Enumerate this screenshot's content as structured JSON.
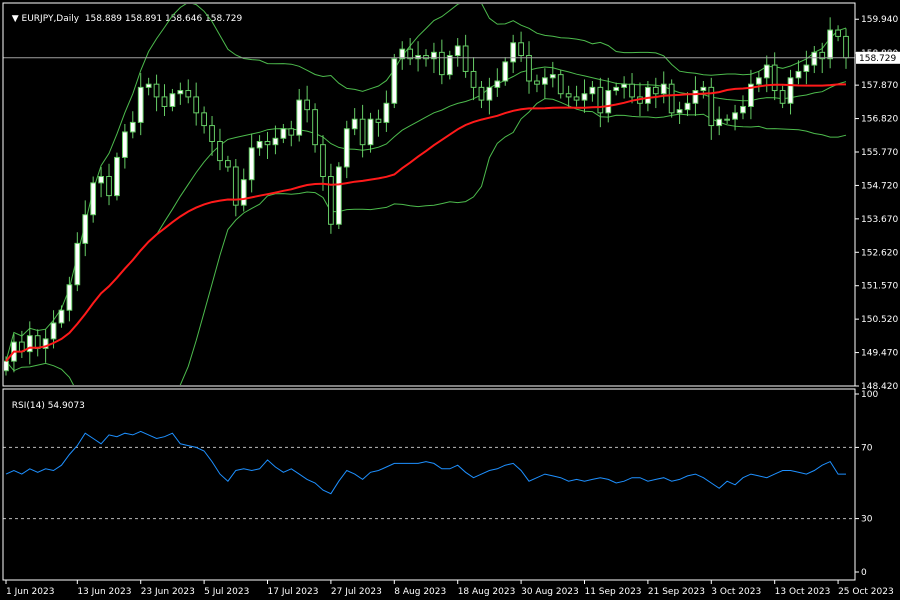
{
  "header": {
    "symbol": "EURJPY,Daily",
    "ohlc": "158.889 158.891 158.646 158.729"
  },
  "chart_data": {
    "type": "candlestick",
    "symbol": "EURJPY",
    "timeframe": "Daily",
    "price_axis": {
      "ylim": [
        148.42,
        160.45
      ],
      "ticks": [
        "159.940",
        "158.880",
        "157.870",
        "156.820",
        "155.770",
        "154.720",
        "153.670",
        "152.620",
        "151.570",
        "150.520",
        "149.470",
        "148.420"
      ]
    },
    "current_price": "158.729",
    "time_axis": {
      "ticks": [
        {
          "label": "1 Jun 2023",
          "index": 0
        },
        {
          "label": "13 Jun 2023",
          "index": 9
        },
        {
          "label": "23 Jun 2023",
          "index": 17
        },
        {
          "label": "5 Jul 2023",
          "index": 25
        },
        {
          "label": "17 Jul 2023",
          "index": 33
        },
        {
          "label": "27 Jul 2023",
          "index": 41
        },
        {
          "label": "8 Aug 2023",
          "index": 49
        },
        {
          "label": "18 Aug 2023",
          "index": 57
        },
        {
          "label": "30 Aug 2023",
          "index": 65
        },
        {
          "label": "11 Sep 2023",
          "index": 73
        },
        {
          "label": "21 Sep 2023",
          "index": 81
        },
        {
          "label": "3 Oct 2023",
          "index": 89
        },
        {
          "label": "13 Oct 2023",
          "index": 97
        },
        {
          "label": "25 Oct 2023",
          "index": 105
        }
      ]
    },
    "closes": [
      149.2,
      149.8,
      149.5,
      150.0,
      149.6,
      149.9,
      150.4,
      150.8,
      151.6,
      152.9,
      153.8,
      154.8,
      155.0,
      154.4,
      155.6,
      156.4,
      156.7,
      157.8,
      157.9,
      157.5,
      157.2,
      157.6,
      157.7,
      157.5,
      157.0,
      156.6,
      156.1,
      155.5,
      155.3,
      154.1,
      154.9,
      155.9,
      156.1,
      156.0,
      156.2,
      156.5,
      156.3,
      157.4,
      157.1,
      156.0,
      155.0,
      153.5,
      155.3,
      156.5,
      156.8,
      156.0,
      156.8,
      156.7,
      157.3,
      158.7,
      159.0,
      158.7,
      158.8,
      158.7,
      158.9,
      158.2,
      158.8,
      159.1,
      158.3,
      157.8,
      157.4,
      157.8,
      158.0,
      158.6,
      159.2,
      158.8,
      158.0,
      157.9,
      158.1,
      158.2,
      157.6,
      157.5,
      157.4,
      157.6,
      157.8,
      157.0,
      157.7,
      157.8,
      157.9,
      157.5,
      157.3,
      157.8,
      157.6,
      157.9,
      157.0,
      157.1,
      157.3,
      157.7,
      157.8,
      156.6,
      156.8,
      156.8,
      157.0,
      157.2,
      157.9,
      158.1,
      158.5,
      157.7,
      157.3,
      158.1,
      158.3,
      158.5,
      158.9,
      158.7,
      159.6,
      159.4,
      158.73
    ],
    "sma_red": {
      "color": "#ff1a1a"
    },
    "bollinger": {
      "color": "#4dbb4d"
    },
    "candle_up_color": "#ffffff",
    "candle_down_color": "#000000",
    "candle_border_color": "#66cc66",
    "rsi": {
      "label": "RSI(14) 54.9073",
      "levels": [
        100,
        70,
        30,
        0
      ],
      "values": [
        55,
        57,
        55,
        58,
        56,
        58,
        57,
        60,
        66,
        71,
        78,
        75,
        72,
        77,
        76,
        78,
        77,
        79,
        77,
        75,
        76,
        78,
        72,
        71,
        70,
        68,
        62,
        55,
        51,
        57,
        58,
        57,
        58,
        63,
        59,
        56,
        58,
        55,
        52,
        50,
        46,
        44,
        51,
        57,
        55,
        52,
        56,
        57,
        59,
        61,
        61,
        61,
        61,
        62,
        61,
        58,
        58,
        60,
        56,
        53,
        55,
        57,
        58,
        60,
        61,
        57,
        51,
        53,
        55,
        54,
        53,
        51,
        52,
        51,
        52,
        53,
        52,
        50,
        51,
        53,
        53,
        51,
        52,
        53,
        51,
        52,
        54,
        55,
        53,
        50,
        47,
        51,
        49,
        53,
        55,
        54,
        53,
        55,
        57,
        57,
        56,
        55,
        57,
        60,
        62,
        55,
        55
      ]
    },
    "colors": {
      "background": "#000000",
      "axis": "#ffffff",
      "rsi_line": "#1e90ff",
      "price_line": "#a0a0a0"
    }
  }
}
